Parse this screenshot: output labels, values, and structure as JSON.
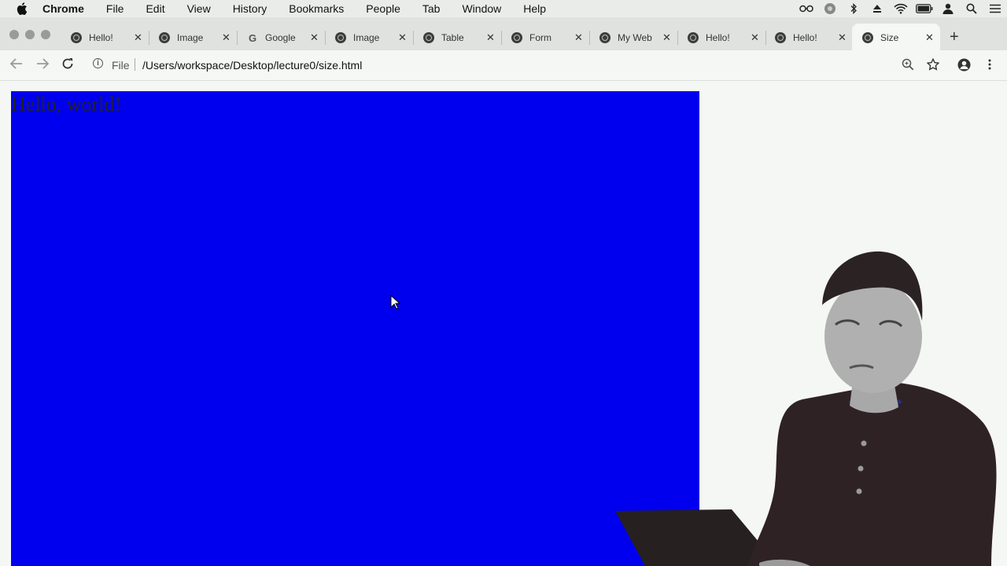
{
  "menubar": {
    "app_name": "Chrome",
    "items": [
      "File",
      "Edit",
      "View",
      "History",
      "Bookmarks",
      "People",
      "Tab",
      "Window",
      "Help"
    ]
  },
  "tabs": [
    {
      "title": "Hello!",
      "icon": "globe-icon"
    },
    {
      "title": "Image",
      "icon": "globe-icon"
    },
    {
      "title": "Google",
      "icon": "google-icon"
    },
    {
      "title": "Image",
      "icon": "globe-icon"
    },
    {
      "title": "Table",
      "icon": "globe-icon"
    },
    {
      "title": "Form",
      "icon": "globe-icon"
    },
    {
      "title": "My Web",
      "icon": "globe-icon"
    },
    {
      "title": "Hello!",
      "icon": "globe-icon"
    },
    {
      "title": "Hello!",
      "icon": "globe-icon"
    },
    {
      "title": "Size",
      "icon": "globe-icon",
      "active": true
    }
  ],
  "toolbar": {
    "scheme_label": "File",
    "url": "/Users/workspace/Desktop/lecture0/size.html"
  },
  "page": {
    "heading": "Hello, world!",
    "box_color": "#0000ee"
  },
  "colors": {
    "tab_strip": "#dfe2df",
    "toolbar": "#f4f7f4",
    "menubar": "#eaecea"
  }
}
